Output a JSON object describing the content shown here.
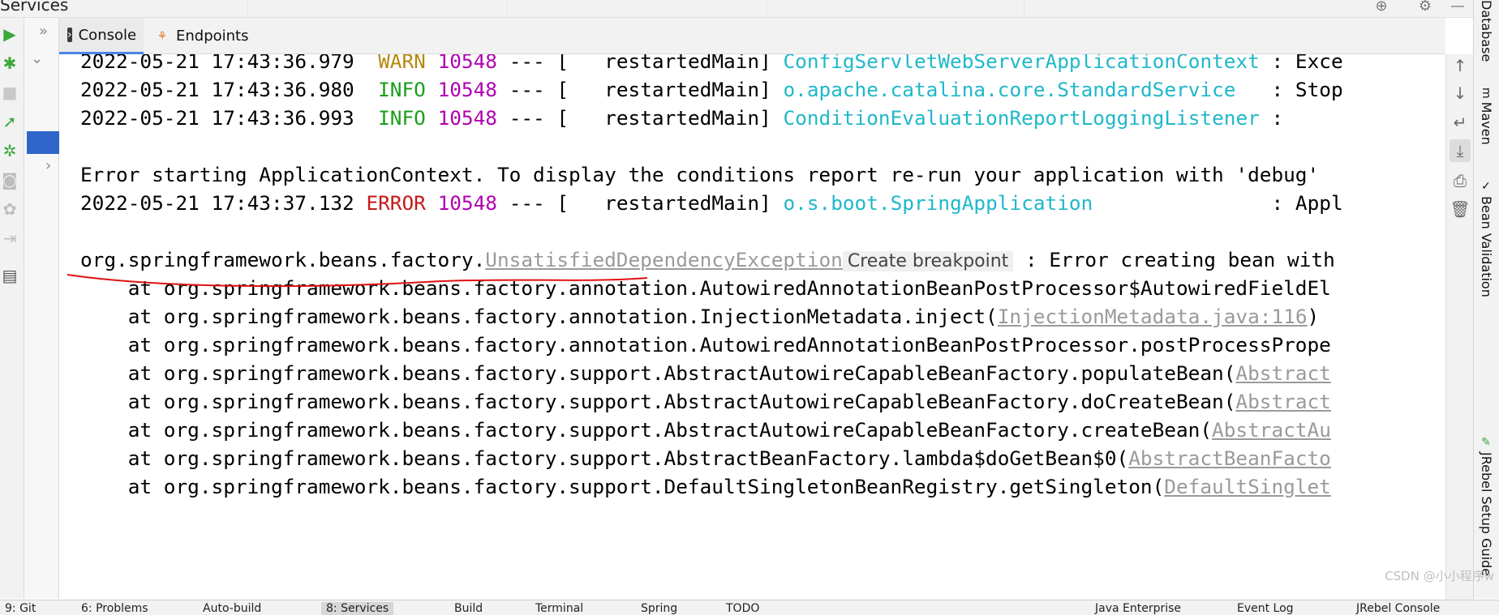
{
  "window": {
    "title": "Services"
  },
  "colors": {
    "warn": "#b8860b",
    "info": "#1a9e1a",
    "error": "#c41a1a",
    "pid": "#b000b0",
    "logger": "#1fb8c9",
    "link": "#9a9a9a",
    "selection": "#2f65ca",
    "annotation": "#e01010"
  },
  "titlebar_icons": [
    "globe-icon",
    "gear-icon",
    "minimize-icon"
  ],
  "left_toolbar": {
    "icons": [
      "run-icon",
      "debug-icon",
      "stop-icon",
      "run-selected-icon",
      "debug-selected-icon",
      "camera-icon",
      "settings-icon",
      "attach-icon",
      "layout-icon"
    ]
  },
  "tabs": [
    {
      "label": "Console",
      "icon": "console-icon",
      "active": true
    },
    {
      "label": "Endpoints",
      "icon": "endpoints-icon",
      "active": false
    }
  ],
  "console": {
    "log_lines": [
      {
        "ts": "2022-05-21 17:43:36.979",
        "level": "WARN",
        "pid": "10548",
        "sep": "--- [",
        "thread": "  restartedMain]",
        "logger": "ConfigServletWebServerApplicationContext",
        "msg": " : Exce"
      },
      {
        "ts": "2022-05-21 17:43:36.980",
        "level": "INFO",
        "pid": "10548",
        "sep": "--- [",
        "thread": "  restartedMain]",
        "logger": "o.apache.catalina.core.StandardService",
        "msg": "   : Stop"
      },
      {
        "ts": "2022-05-21 17:43:36.993",
        "level": "INFO",
        "pid": "10548",
        "sep": "--- [",
        "thread": "  restartedMain]",
        "logger": "ConditionEvaluationReportLoggingListener",
        "msg": " :"
      }
    ],
    "error_message": "Error starting ApplicationContext. To display the conditions report re-run your application with 'debug' ",
    "error_line": {
      "ts": "2022-05-21 17:43:37.132",
      "level": "ERROR",
      "pid": "10548",
      "sep": "--- [",
      "thread": "  restartedMain]",
      "logger": "o.s.boot.SpringApplication",
      "msg": "               : Appl"
    },
    "exception": {
      "prefix": "org.springframework.beans.factory.",
      "link": "UnsatisfiedDependencyException",
      "breakpoint": "Create breakpoint",
      "suffix": " : Error creating bean with"
    },
    "stack": [
      {
        "text": "    at org.springframework.beans.factory.annotation.AutowiredAnnotationBeanPostProcessor$AutowiredFieldEl",
        "link": ""
      },
      {
        "text": "    at org.springframework.beans.factory.annotation.InjectionMetadata.inject(",
        "link": "InjectionMetadata.java:116",
        "close": ")"
      },
      {
        "text": "    at org.springframework.beans.factory.annotation.AutowiredAnnotationBeanPostProcessor.postProcessPrope",
        "link": ""
      },
      {
        "text": "    at org.springframework.beans.factory.support.AbstractAutowireCapableBeanFactory.populateBean(",
        "link": "Abstract"
      },
      {
        "text": "    at org.springframework.beans.factory.support.AbstractAutowireCapableBeanFactory.doCreateBean(",
        "link": "Abstract"
      },
      {
        "text": "    at org.springframework.beans.factory.support.AbstractAutowireCapableBeanFactory.createBean(",
        "link": "AbstractAu"
      },
      {
        "text": "    at org.springframework.beans.factory.support.AbstractBeanFactory.lambda$doGetBean$0(",
        "link": "AbstractBeanFacto"
      },
      {
        "text": "    at org.springframework.beans.factory.support.DefaultSingletonBeanRegistry.getSingleton(",
        "link": "DefaultSinglet"
      }
    ]
  },
  "right_toolbar": {
    "icons": [
      "up-arrow-icon",
      "down-arrow-icon",
      "soft-wrap-icon",
      "scroll-to-end-icon",
      "print-icon",
      "trash-icon"
    ]
  },
  "side_tabs": [
    {
      "label": "Database",
      "icon": "database-icon"
    },
    {
      "label": "Maven",
      "icon": "maven-icon"
    },
    {
      "label": "Bean Validation",
      "icon": "bean-validation-icon"
    },
    {
      "label": "JRebel Setup Guide",
      "icon": "jrebel-icon"
    }
  ],
  "status_bar": {
    "items": [
      {
        "label": "9: Git",
        "icon": "git-icon"
      },
      {
        "label": "6: Problems",
        "icon": "problems-icon"
      },
      {
        "label": "Auto-build",
        "icon": "build-icon"
      },
      {
        "label": "8: Services",
        "icon": "services-icon",
        "active": true
      },
      {
        "label": "Build",
        "icon": "hammer-icon"
      },
      {
        "label": "Terminal",
        "icon": "terminal-icon"
      },
      {
        "label": "Spring",
        "icon": "spring-icon"
      },
      {
        "label": "TODO",
        "icon": "todo-icon"
      },
      {
        "label": "Java Enterprise",
        "icon": "java-icon"
      },
      {
        "label": "Event Log",
        "icon": "event-log-icon"
      },
      {
        "label": "JRebel Console",
        "icon": "jrebel-console-icon"
      }
    ]
  },
  "watermark": "CSDN @小小程序w"
}
